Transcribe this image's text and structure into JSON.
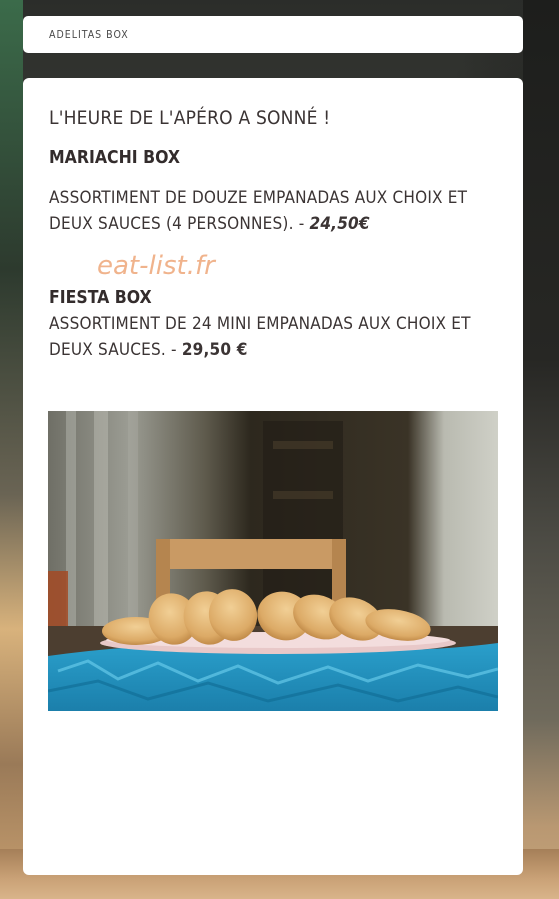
{
  "breadcrumb": {
    "label": "ADELITAS BOX"
  },
  "card": {
    "headline": "L'HEURE DE L'APÉRO A SONNÉ !",
    "watermark": "eat-list.fr",
    "items": [
      {
        "name": "MARIACHI BOX",
        "description": "ASSORTIMENT DE DOUZE EMPANADAS AUX CHOIX ET DEUX SAUCES (4 PERSONNES). - ",
        "price": "24,50€"
      },
      {
        "name": "FIESTA BOX",
        "description": "ASSORTIMENT DE 24 MINI EMPANADAS AUX CHOIX ET DEUX SAUCES. - ",
        "price": "29,50 €"
      }
    ]
  },
  "colors": {
    "watermark": "#f0b38c",
    "text": "#3b3434",
    "card_bg": "#ffffff",
    "tablecloth": "#1f8fb8"
  }
}
